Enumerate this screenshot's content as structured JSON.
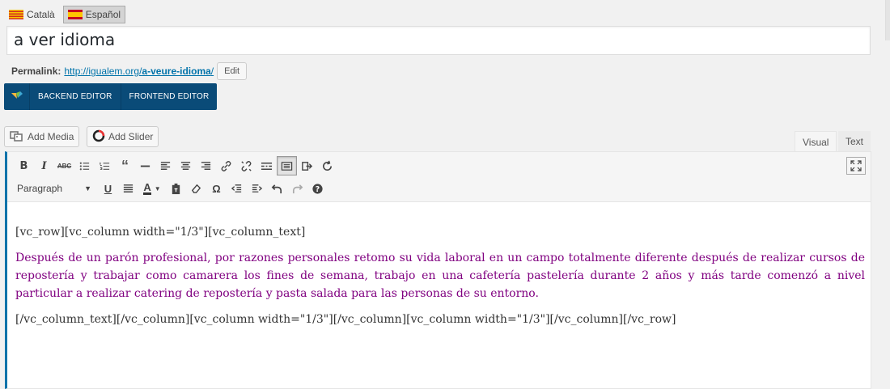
{
  "languages": {
    "items": [
      {
        "label": "Català",
        "active": false
      },
      {
        "label": "Español",
        "active": true
      }
    ]
  },
  "post": {
    "title": "a ver idioma"
  },
  "permalink": {
    "label": "Permalink:",
    "base": "http://igualem.org/",
    "slug": "a-veure-idioma",
    "trailing": "/",
    "edit_label": "Edit"
  },
  "vc": {
    "backend_label": "BACKEND EDITOR",
    "frontend_label": "FRONTEND EDITOR"
  },
  "media": {
    "add_media_label": "Add Media",
    "add_slider_label": "Add Slider"
  },
  "editor_tabs": {
    "visual": "Visual",
    "text": "Text"
  },
  "toolbar": {
    "format_value": "Paragraph",
    "row1_icons": [
      "bold-icon",
      "italic-icon",
      "strikethrough-icon",
      "bullet-list-icon",
      "numbered-list-icon",
      "blockquote-icon",
      "horizontal-line-icon",
      "align-left-icon",
      "align-center-icon",
      "align-right-icon",
      "link-icon",
      "unlink-icon",
      "read-more-icon",
      "toolbar-toggle-icon",
      "insert-icon",
      "refresh-icon"
    ],
    "row2_icons": [
      "underline-icon",
      "justify-icon",
      "text-color-icon",
      "paste-text-icon",
      "clear-formatting-icon",
      "special-character-icon",
      "outdent-icon",
      "indent-icon",
      "undo-icon",
      "redo-icon",
      "help-icon"
    ],
    "fullscreen_icon": "fullscreen-icon"
  },
  "content": {
    "line1": "[vc_row][vc_column width=\"1/3\"][vc_column_text]",
    "paragraph": "Después de un parón profesional, por razones personales retomo su vida laboral en un campo totalmente diferente después de realizar cursos de repostería y trabajar como camarera los fines de semana, trabajo en una cafetería pastelería durante 2 años y más tarde comenzó a nivel particular a realizar catering de repostería y pasta salada para las personas de su entorno.",
    "line3": "[/vc_column_text][/vc_column][vc_column width=\"1/3\"][/vc_column][vc_column width=\"1/3\"][/vc_column][/vc_row]"
  },
  "colors": {
    "vc_bar": "#0a4b78",
    "link": "#0073aa",
    "paragraph_text": "#800080"
  }
}
